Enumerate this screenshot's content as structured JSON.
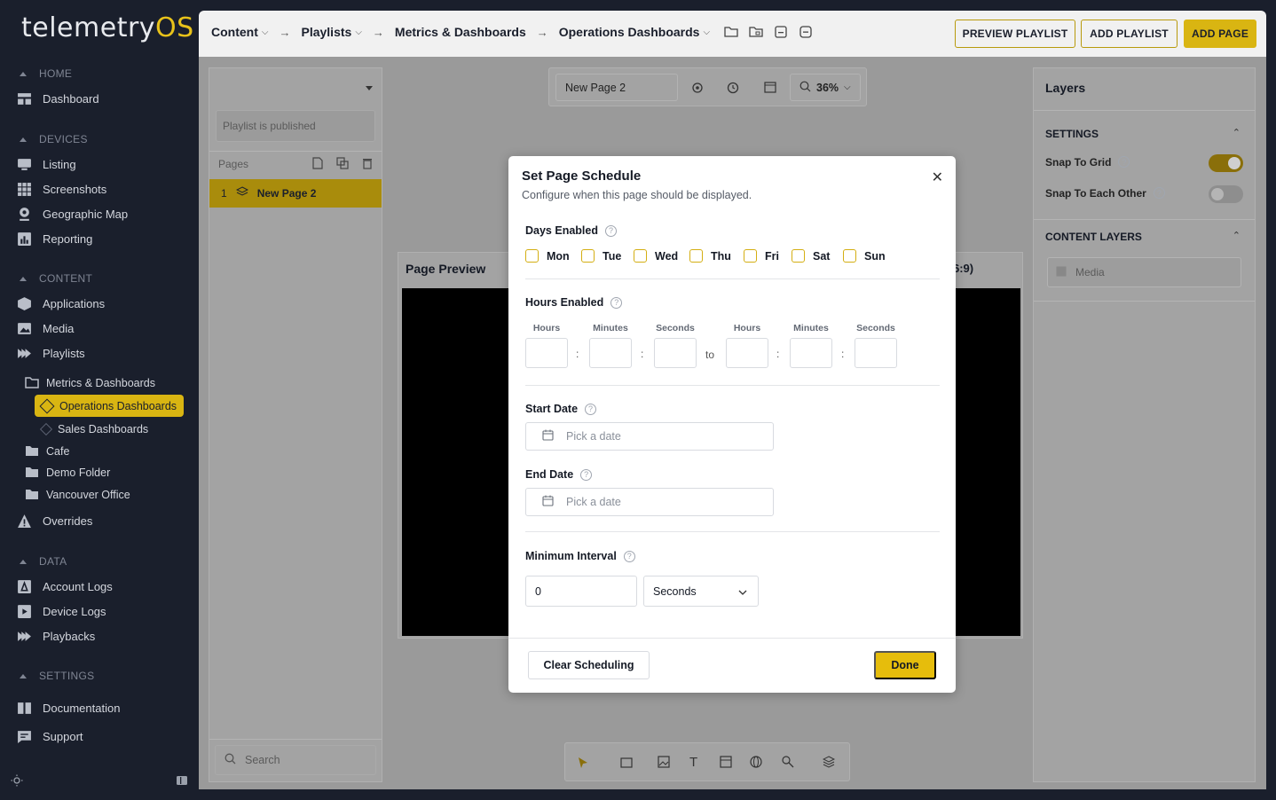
{
  "brand": {
    "name": "telemetry",
    "suffix": "OS",
    "accent": "#e8c21a"
  },
  "sidebar": {
    "sections": [
      {
        "title": "HOME"
      },
      {
        "title": "DEVICES"
      },
      {
        "title": "CONTENT"
      },
      {
        "title": "DATA"
      },
      {
        "title": "SETTINGS"
      }
    ],
    "items": {
      "dashboard": "Dashboard",
      "listing": "Listing",
      "screenshots": "Screenshots",
      "geographic_map": "Geographic Map",
      "reporting": "Reporting",
      "applications": "Applications",
      "media": "Media",
      "playlists": "Playlists",
      "overrides": "Overrides",
      "account_logs": "Account Logs",
      "device_logs": "Device Logs",
      "playbacks": "Playbacks",
      "documentation": "Documentation",
      "support": "Support"
    },
    "tree": {
      "metrics": "Metrics & Dashboards",
      "operations": "Operations Dashboards",
      "sales": "Sales Dashboards",
      "cafe": "Cafe",
      "demo": "Demo Folder",
      "vancouver": "Vancouver Office"
    }
  },
  "topbar": {
    "crumbs": [
      "Content",
      "Playlists",
      "Metrics & Dashboards",
      "Operations Dashboards"
    ],
    "preview_btn": "PREVIEW PLAYLIST",
    "add_playlist_btn": "ADD PLAYLIST",
    "add_page_btn": "ADD PAGE"
  },
  "left_panel": {
    "status": "Playlist is published",
    "pages_label": "Pages",
    "page_num": "1",
    "page_name": "New Page 2",
    "search_placeholder": "Search"
  },
  "canvas": {
    "page_name_value": "New Page 2",
    "zoom": "36%",
    "preview_title": "Page Preview",
    "aspect_partial": "6:9)"
  },
  "right_panel": {
    "title": "Layers",
    "settings_label": "SETTINGS",
    "snap_grid": "Snap To Grid",
    "snap_grid_on": true,
    "snap_each": "Snap To Each Other",
    "snap_each_on": false,
    "content_layers": "CONTENT LAYERS",
    "layer_media": "Media"
  },
  "modal": {
    "title": "Set Page Schedule",
    "subtitle": "Configure when this page should be displayed.",
    "days_label": "Days Enabled",
    "days": [
      "Mon",
      "Tue",
      "Wed",
      "Thu",
      "Fri",
      "Sat",
      "Sun"
    ],
    "hours_label": "Hours Enabled",
    "time_labels": [
      "Hours",
      "Minutes",
      "Seconds",
      "Hours",
      "Minutes",
      "Seconds"
    ],
    "to_label": "to",
    "time_sep": ":",
    "start_label": "Start Date",
    "end_label": "End Date",
    "date_placeholder": "Pick a date",
    "interval_label": "Minimum Interval",
    "interval_value": "0",
    "interval_unit": "Seconds",
    "clear_btn": "Clear Scheduling",
    "done_btn": "Done",
    "help_glyph": "?",
    "close_glyph": "✕"
  }
}
